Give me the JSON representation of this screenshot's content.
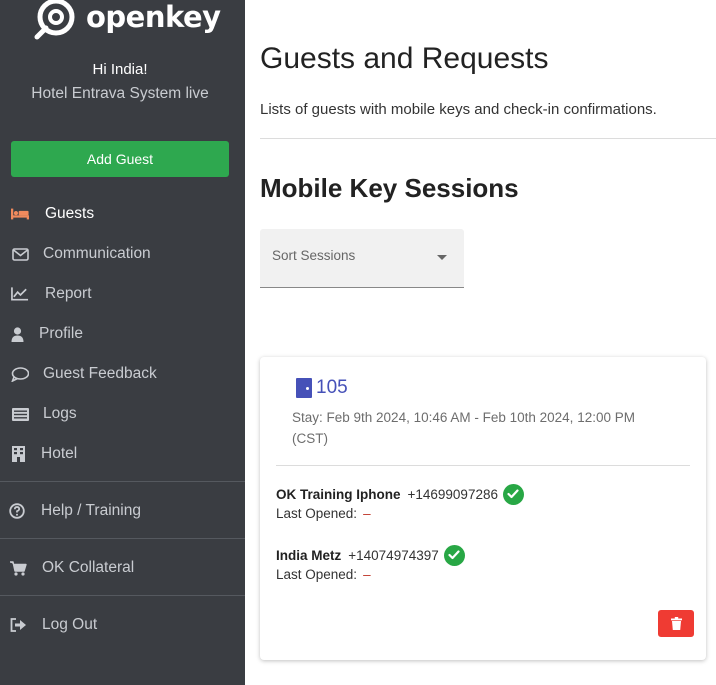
{
  "brand": {
    "name": "openkey"
  },
  "sidebar": {
    "greeting": "Hi India!",
    "system": "Hotel Entrava System live",
    "add_guest_label": "Add Guest",
    "items": [
      {
        "label": "Guests",
        "icon": "bed-icon"
      },
      {
        "label": "Communication",
        "icon": "envelope-icon"
      },
      {
        "label": "Report",
        "icon": "chart-line-icon"
      },
      {
        "label": "Profile",
        "icon": "user-icon"
      },
      {
        "label": "Guest Feedback",
        "icon": "comment-icon"
      },
      {
        "label": "Logs",
        "icon": "list-icon"
      },
      {
        "label": "Hotel",
        "icon": "building-icon"
      },
      {
        "label": "Help / Training",
        "icon": "question-circle-icon"
      },
      {
        "label": "OK Collateral",
        "icon": "cart-icon"
      },
      {
        "label": "Log Out",
        "icon": "sign-out-icon"
      }
    ]
  },
  "main": {
    "title": "Guests and Requests",
    "subtitle": "Lists of guests with mobile keys and check-in confirmations.",
    "section_title": "Mobile Key Sessions",
    "sort_label": "Sort Sessions",
    "session": {
      "room": "105",
      "stay": "Stay: Feb 9th 2024, 10:46 AM - Feb 10th 2024, 12:00 PM (CST)",
      "guests": [
        {
          "name": "OK Training Iphone",
          "phone": "+14699097286",
          "last_opened_label": "Last Opened:",
          "last_opened": "–"
        },
        {
          "name": "India Metz",
          "phone": "+14074974397",
          "last_opened_label": "Last Opened:",
          "last_opened": "–"
        }
      ]
    }
  },
  "colors": {
    "sidebar_bg": "#3a3d42",
    "add_button": "#2ea84f",
    "active_icon": "#f08a5d",
    "room_accent": "#4651b8",
    "check": "#28a745",
    "delete": "#ef3b33"
  }
}
